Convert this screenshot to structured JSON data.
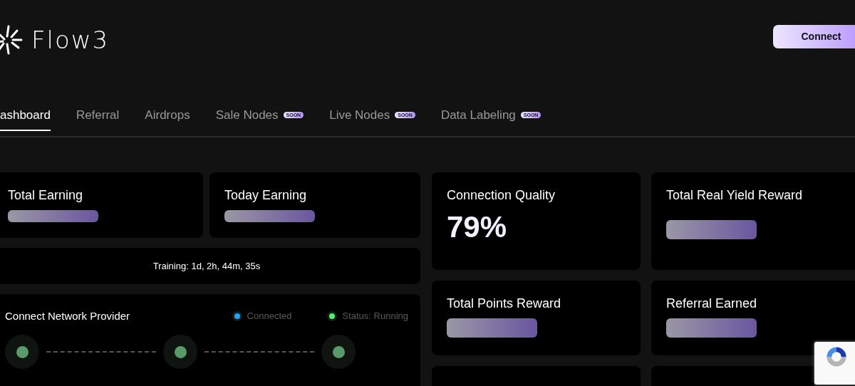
{
  "logo": {
    "text": "Flow3"
  },
  "connect_button": "Connect",
  "tabs": [
    {
      "label": "ashboard",
      "selected": true
    },
    {
      "label": "Referral",
      "selected": false
    },
    {
      "label": "Airdrops",
      "selected": false
    },
    {
      "label": "Sale Nodes",
      "selected": false,
      "badge": "SOON"
    },
    {
      "label": "Live Nodes",
      "selected": false,
      "badge": "SOON"
    },
    {
      "label": "Data Labeling",
      "selected": false,
      "badge": "SOON"
    }
  ],
  "earnings": [
    {
      "title": "Total Earning"
    },
    {
      "title": "Today Earning"
    }
  ],
  "training": "Training: 1d, 2h, 44m, 35s",
  "network": {
    "title": "Connect Network Provider",
    "legend": [
      {
        "label": "Connected",
        "color": "#1aa7ff"
      },
      {
        "label": "Status: Running",
        "color": "#4ef06a"
      }
    ]
  },
  "stats": [
    {
      "title": "Connection Quality",
      "value": "79%"
    },
    {
      "title": "Total Real Yield Reward"
    },
    {
      "title": "Total Points Reward"
    },
    {
      "title": "Referral Earned"
    }
  ]
}
